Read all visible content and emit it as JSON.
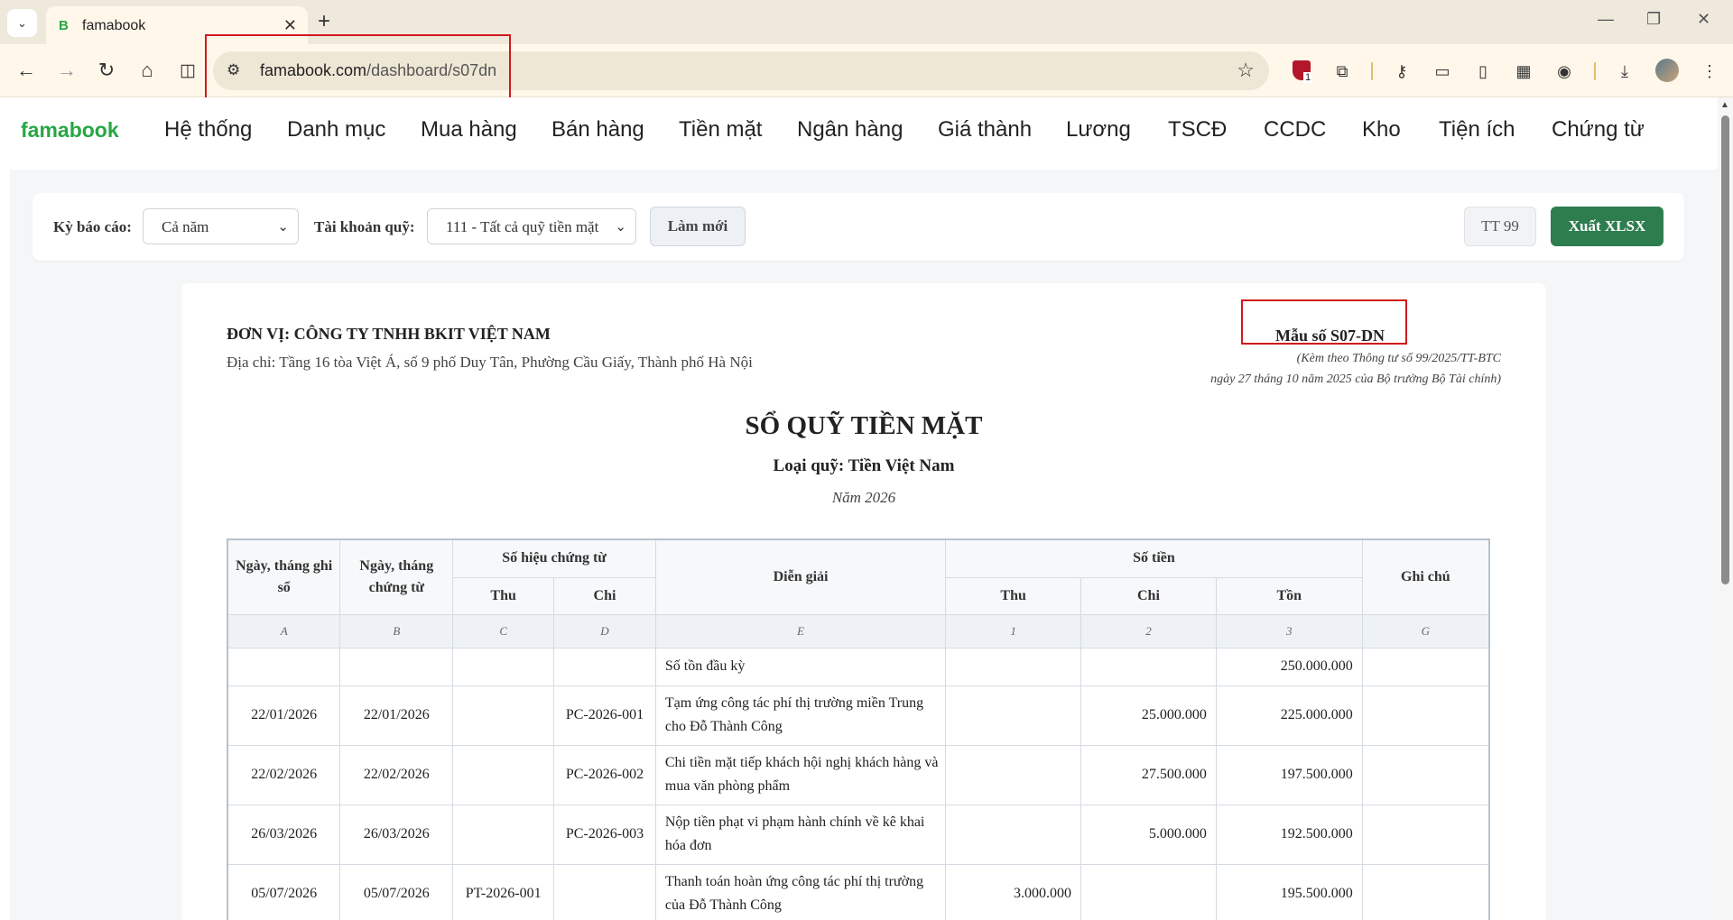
{
  "browser": {
    "tab_title": "famabook",
    "tab_favicon": "B",
    "url_host": "famabook.com",
    "url_path": "/dashboard/s07dn",
    "extension_badge": "1"
  },
  "app": {
    "logo": "famabook",
    "nav": [
      "Hệ thống",
      "Danh mục",
      "Mua hàng",
      "Bán hàng",
      "Tiền mặt",
      "Ngân hàng",
      "Giá thành",
      "Lương",
      "TSCĐ",
      "CCDC",
      "Kho",
      "Tiện ích",
      "Chứng từ"
    ]
  },
  "filters": {
    "period_label": "Kỳ báo cáo:",
    "period_value": "Cả năm",
    "account_label": "Tài khoản quỹ:",
    "account_value": "111 - Tất cả quỹ tiền mặt",
    "refresh_label": "Làm mới",
    "circular_label": "TT 99",
    "export_label": "Xuất XLSX"
  },
  "report": {
    "org": "ĐƠN VỊ: CÔNG TY TNHH BKIT VIỆT NAM",
    "address": "Địa chỉ: Tầng 16 tòa Việt Á, số 9 phố Duy Tân, Phường Cầu Giấy, Thành phố Hà Nội",
    "form_no": "Mẫu số S07-DN",
    "form_note_1": "(Kèm theo Thông tư số 99/2025/TT-BTC",
    "form_note_2": "ngày 27 tháng 10 năm 2025 của Bộ trưởng Bộ Tài chính)",
    "title": "SỔ QUỸ TIỀN MẶT",
    "subtitle": "Loại quỹ: Tiền Việt Nam",
    "year": "Năm 2026"
  },
  "table": {
    "headers": {
      "record_date": "Ngày, tháng ghi sổ",
      "doc_date": "Ngày, tháng chứng từ",
      "doc_no": "Số hiệu chứng từ",
      "doc_in": "Thu",
      "doc_out": "Chi",
      "desc": "Diễn giải",
      "amount": "Số tiền",
      "amt_in": "Thu",
      "amt_out": "Chi",
      "balance": "Tồn",
      "note": "Ghi chú"
    },
    "codes": [
      "A",
      "B",
      "C",
      "D",
      "E",
      "1",
      "2",
      "3",
      "G"
    ],
    "opening": {
      "desc": "Số tồn đầu kỳ",
      "balance": "250.000.000"
    },
    "rows": [
      {
        "record_date": "22/01/2026",
        "doc_date": "22/01/2026",
        "doc_in": "",
        "doc_out": "PC-2026-001",
        "desc": "Tạm ứng công tác phí thị trường miền Trung cho Đỗ Thành Công",
        "amt_in": "",
        "amt_out": "25.000.000",
        "balance": "225.000.000",
        "note": ""
      },
      {
        "record_date": "22/02/2026",
        "doc_date": "22/02/2026",
        "doc_in": "",
        "doc_out": "PC-2026-002",
        "desc": "Chi tiền mặt tiếp khách hội nghị khách hàng và mua văn phòng phẩm",
        "amt_in": "",
        "amt_out": "27.500.000",
        "balance": "197.500.000",
        "note": ""
      },
      {
        "record_date": "26/03/2026",
        "doc_date": "26/03/2026",
        "doc_in": "",
        "doc_out": "PC-2026-003",
        "desc": "Nộp tiền phạt vi phạm hành chính về kê khai hóa đơn",
        "amt_in": "",
        "amt_out": "5.000.000",
        "balance": "192.500.000",
        "note": ""
      },
      {
        "record_date": "05/07/2026",
        "doc_date": "05/07/2026",
        "doc_in": "PT-2026-001",
        "doc_out": "",
        "desc": "Thanh toán hoàn ứng công tác phí thị trường của Đỗ Thành Công",
        "amt_in": "3.000.000",
        "amt_out": "",
        "balance": "195.500.000",
        "note": ""
      }
    ]
  },
  "colors": {
    "brand_green": "#28a745",
    "export_button": "#2e7d4f",
    "highlight_box": "#d0191c"
  }
}
